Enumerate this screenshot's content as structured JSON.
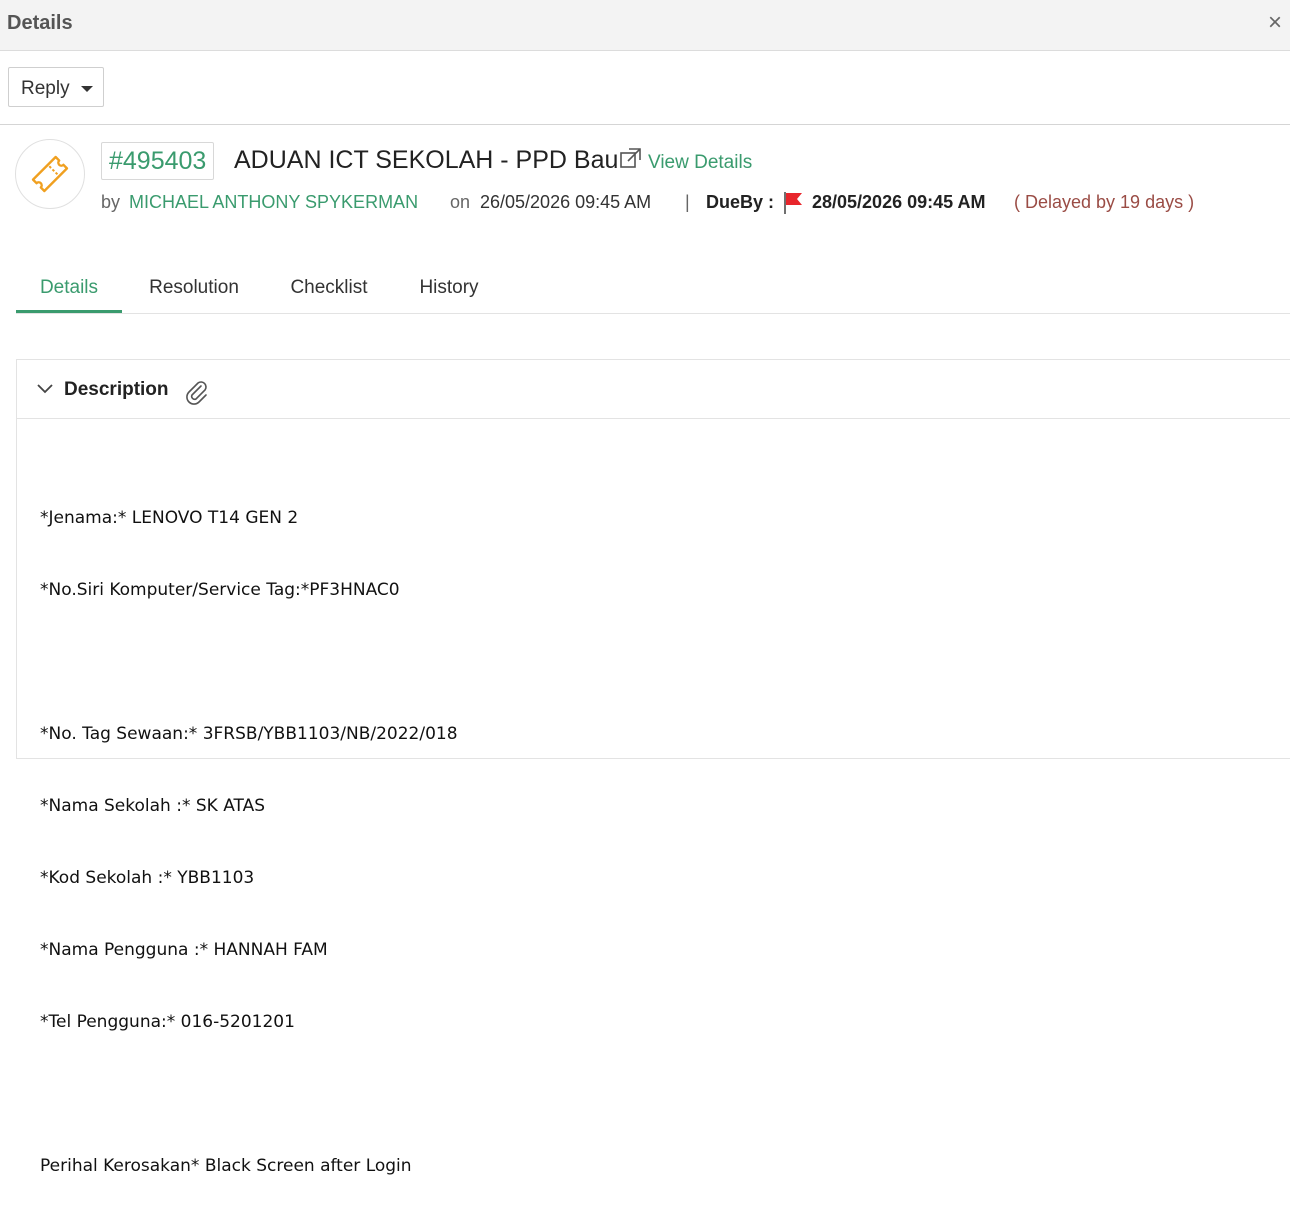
{
  "window": {
    "title": "Details",
    "close_glyph": "×"
  },
  "toolbar": {
    "reply_label": "Reply"
  },
  "ticket": {
    "id": "#495403",
    "title": "ADUAN ICT SEKOLAH - PPD Bau",
    "view_details_label": "View Details",
    "by_label": "by",
    "author": "MICHAEL ANTHONY SPYKERMAN",
    "on_label": "on",
    "created": "26/05/2026 09:45 AM",
    "separator": "|",
    "dueby_label": "DueBy :",
    "due": "28/05/2026 09:45 AM",
    "delay": "( Delayed by 19 days )",
    "icon": "ticket-icon",
    "accent_color": "#3a9b6e",
    "ticket_icon_color": "#f0a020",
    "flag_color": "#e8262c",
    "delay_color": "#9a4c45"
  },
  "tabs": [
    {
      "label": "Details",
      "active": true
    },
    {
      "label": "Resolution",
      "active": false
    },
    {
      "label": "Checklist",
      "active": false
    },
    {
      "label": "History",
      "active": false
    }
  ],
  "description": {
    "title": "Description",
    "lines": [
      "*Jenama:* LENOVO T14 GEN 2",
      "*No.Siri Komputer/Service Tag:*PF3HNAC0",
      "",
      "*No. Tag Sewaan:* 3FRSB/YBB1103/NB/2022/018",
      "*Nama Sekolah :* SK ATAS",
      "*Kod Sekolah :* YBB1103",
      "*Nama Pengguna :* HANNAH FAM",
      "*Tel Pengguna:* 016-5201201",
      "",
      "Perihal Kerosakan* Black Screen after Login"
    ]
  }
}
